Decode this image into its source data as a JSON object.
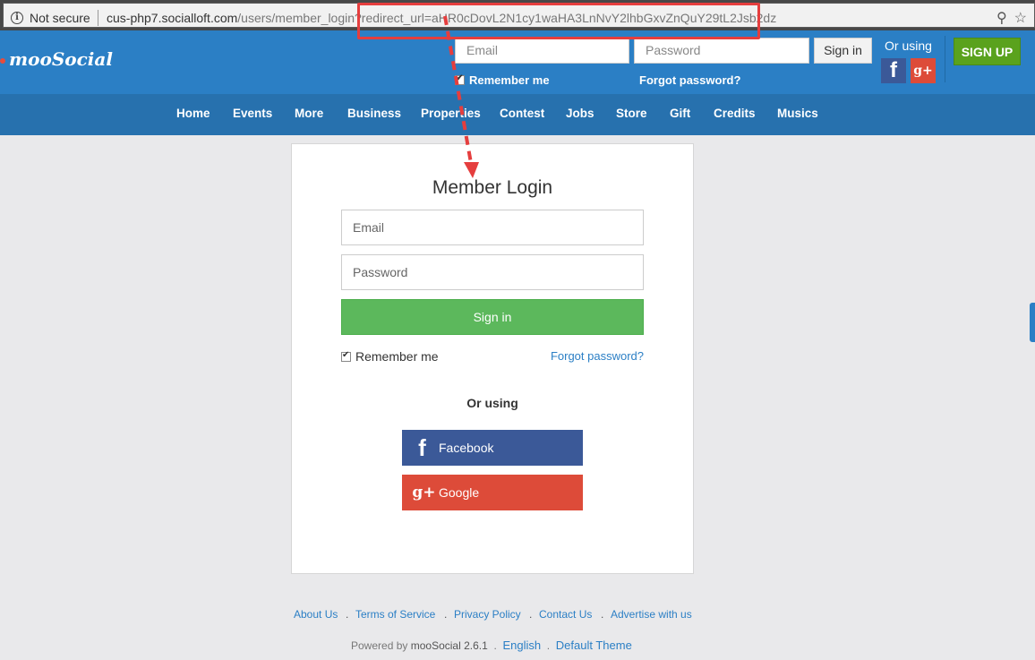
{
  "browser": {
    "security_label": "Not secure",
    "url_host": "cus-php7.socialloft.com",
    "url_path": "/users/member_login?redirect_url=aHR0cDovL2N1cy1waHA3LnNvY2lhbGxvZnQuY29tL2Jsb2dz"
  },
  "header": {
    "logo": "mooSocial",
    "email_placeholder": "Email",
    "password_placeholder": "Password",
    "signin_label": "Sign in",
    "remember_label": "Remember me",
    "forgot_label": "Forgot password?",
    "or_using": "Or using",
    "signup_label": "SIGN UP"
  },
  "nav": [
    "Home",
    "Events",
    "More",
    "Business",
    "Properties",
    "Contest",
    "Jobs",
    "Store",
    "Gift",
    "Credits",
    "Musics"
  ],
  "login": {
    "title": "Member Login",
    "email_placeholder": "Email",
    "password_placeholder": "Password",
    "signin_label": "Sign in",
    "remember_label": "Remember me",
    "forgot_label": "Forgot password?",
    "or_using": "Or using",
    "facebook_label": "Facebook",
    "google_label": "Google"
  },
  "footer": {
    "links": [
      "About Us",
      "Terms of Service",
      "Privacy Policy",
      "Contact Us",
      "Advertise with us"
    ],
    "powered_by": "Powered by",
    "brand_version": "mooSocial 2.6.1",
    "language": "English",
    "theme": "Default Theme"
  },
  "colors": {
    "header": "#2b7fc5",
    "nav": "#2771ae",
    "signin_green": "#5cb85c",
    "facebook": "#3b5998",
    "google": "#dd4b39",
    "signup": "#5aa21d",
    "annotation": "#e53e3e"
  }
}
